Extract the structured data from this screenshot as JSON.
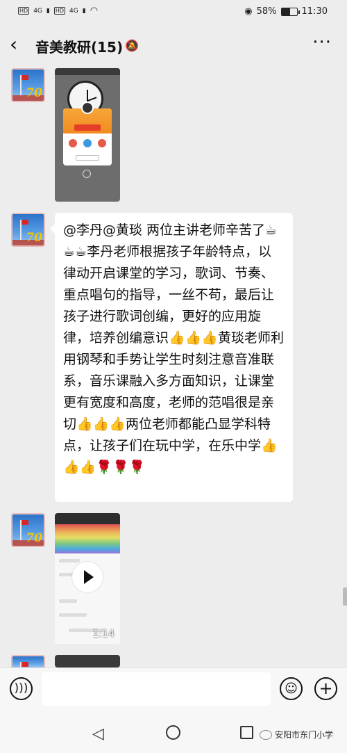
{
  "status_bar": {
    "network_tags": [
      "HD",
      "HD"
    ],
    "signal_labels": [
      "4G",
      "4G"
    ],
    "battery_percent": "58%",
    "battery_level": 0.58,
    "time": "11:30",
    "icons": [
      "eye-icon",
      "wifi-icon",
      "signal-icon",
      "battery-icon"
    ]
  },
  "header": {
    "title": "音美教研(15)",
    "back_icon": "chevron-left-icon",
    "mute_icon": "bell-off-icon",
    "more_icon": "more-dots-icon",
    "more_label": "···"
  },
  "messages": [
    {
      "type": "image",
      "sender_avatar": "flag-70-avatar"
    },
    {
      "type": "text",
      "text": "@李丹@黄琰 两位主讲老师辛苦了☕☕☕李丹老师根据孩子年龄特点，以律动开启课堂的学习，歌词、节奏、重点唱句的指导，一丝不苟，最后让孩子进行歌词创编，更好的应用旋律，培养创编意识👍👍👍黄琰老师利用钢琴和手势让学生时刻注意音准联系，音乐课融入多方面知识，让课堂更有宽度和高度，老师的范唱很是亲切👍👍👍两位老师都能凸显学科特点，让孩子们在玩中学，在乐中学👍👍👍🌹🌹🌹"
    },
    {
      "type": "video",
      "duration": "1:14"
    },
    {
      "type": "image"
    }
  ],
  "input_bar": {
    "voice_icon": "voice-icon",
    "emoji_icon": "emoji-icon",
    "plus_icon": "plus-icon",
    "placeholder": ""
  },
  "nav_bar": {
    "watermark": "安阳市东门小学"
  },
  "colors": {
    "background": "#ededed",
    "bubble": "#ffffff",
    "bar": "#f7f7f7"
  }
}
